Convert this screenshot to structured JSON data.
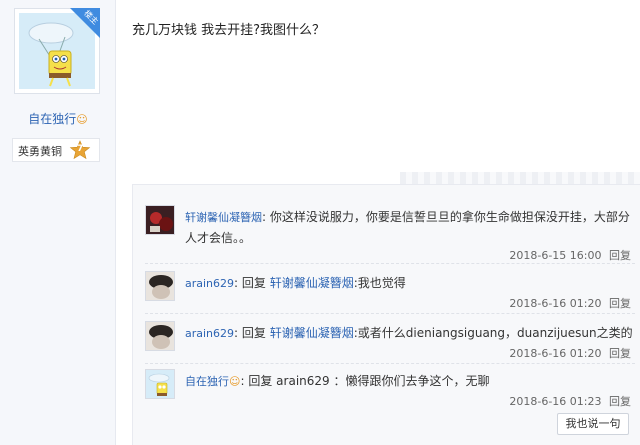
{
  "author": {
    "badge": "楼主",
    "name": "自在独行",
    "level_title": "英勇黄铜",
    "level_number": "7"
  },
  "post": {
    "content": "充几万块钱 我去开挂?我图什么？"
  },
  "replies": [
    {
      "user": "轩谢馨仙凝簪烟",
      "text": "你这样没说服力，你要是信誓旦旦的拿你生命做担保没开挂，大部分人才会信。。",
      "time": "2018-6-15 16:00",
      "action": "回复"
    },
    {
      "user": "arain629",
      "reply_word": "回复",
      "target": "轩谢馨仙凝簪烟",
      "text": ":我也觉得",
      "time": "2018-6-16 01:20",
      "action": "回复"
    },
    {
      "user": "arain629",
      "reply_word": "回复",
      "target": "轩谢馨仙凝簪烟",
      "text": ":或者什么dieniangsiguang，duanzijuesun之类的",
      "time": "2018-6-16 01:20",
      "action": "回复"
    },
    {
      "user": "自在独行",
      "reply_word": "回复",
      "target": "arain629",
      "text": "：懒得跟你们去争这个，无聊",
      "time": "2018-6-16 01:23",
      "action": "回复"
    }
  ],
  "say_button": "我也说一句",
  "colors": {
    "link": "#2d64b3",
    "badge": "#3f8be0",
    "star": "#e8a435"
  }
}
